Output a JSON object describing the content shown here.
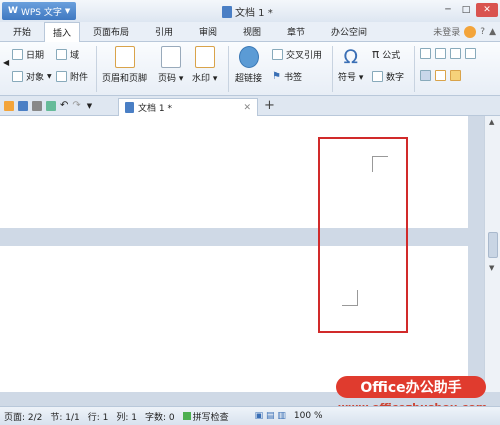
{
  "app": {
    "name": "WPS 文字",
    "logo": "W"
  },
  "window": {
    "title": "文档 1 *"
  },
  "menu": {
    "tabs": [
      "开始",
      "插入",
      "页面布局",
      "引用",
      "审阅",
      "视图",
      "章节",
      "办公空间"
    ],
    "active": "插入",
    "login": "未登录"
  },
  "ribbon": {
    "date": "日期",
    "field": "域",
    "object": "对象",
    "attachment": "附件",
    "header_footer": "页眉和页脚",
    "page_number": "页码",
    "watermark": "水印",
    "hyperlink": "超链接",
    "cross_ref": "交叉引用",
    "bookmark": "书签",
    "symbol": "符号",
    "formula": "公式",
    "number": "数字"
  },
  "doc_tab": {
    "title": "文档 1 *"
  },
  "status": {
    "page": "页面: 2/2",
    "section": "节: 1/1",
    "row": "行: 1",
    "col": "列: 1",
    "words": "字数: 0",
    "spell": "拼写检查",
    "zoom": "100 %"
  },
  "watermark_overlay": {
    "brand": "Office办公助手",
    "url": "www.officezhushou.com"
  },
  "colors": {
    "accent": "#3f78c1",
    "highlight": "#d12a2a"
  }
}
